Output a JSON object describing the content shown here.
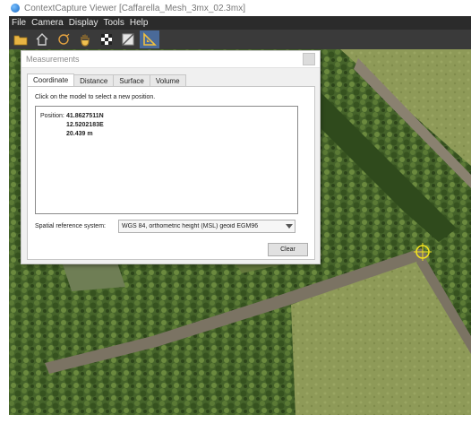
{
  "window": {
    "title": "ContextCapture Viewer [Caffarella_Mesh_3mx_02.3mx]"
  },
  "menu": [
    {
      "label": "File"
    },
    {
      "label": "Camera"
    },
    {
      "label": "Display"
    },
    {
      "label": "Tools"
    },
    {
      "label": "Help"
    }
  ],
  "toolbar": {
    "buttons": [
      {
        "icon": "open-folder-icon"
      },
      {
        "icon": "home-icon"
      },
      {
        "icon": "orbit-icon"
      },
      {
        "icon": "pan-hand-icon"
      },
      {
        "icon": "checkerboard-icon"
      },
      {
        "icon": "texture-icon"
      },
      {
        "icon": "measure-triangle-icon",
        "active": true
      }
    ]
  },
  "dialog": {
    "title": "Measurements",
    "tabs": [
      {
        "label": "Coordinate",
        "active": true
      },
      {
        "label": "Distance"
      },
      {
        "label": "Surface"
      },
      {
        "label": "Volume"
      }
    ],
    "instruction": "Click on the model to select a new position.",
    "position": {
      "label": "Position:",
      "latitude": "41.8627511N",
      "longitude": "12.5202183E",
      "altitude": "20.439 m"
    },
    "srs": {
      "label": "Spatial reference system:",
      "value": "WGS 84, orthometric height (MSL) geoid EGM96"
    },
    "clear_label": "Clear"
  },
  "colors": {
    "menu_bar": "#2b2b2b",
    "toolbar": "#3a3a3a",
    "measure_marker": "#f2e21e",
    "vegetation": "#3e5a25",
    "field": "#8e9a58",
    "path": "#7b7363"
  }
}
